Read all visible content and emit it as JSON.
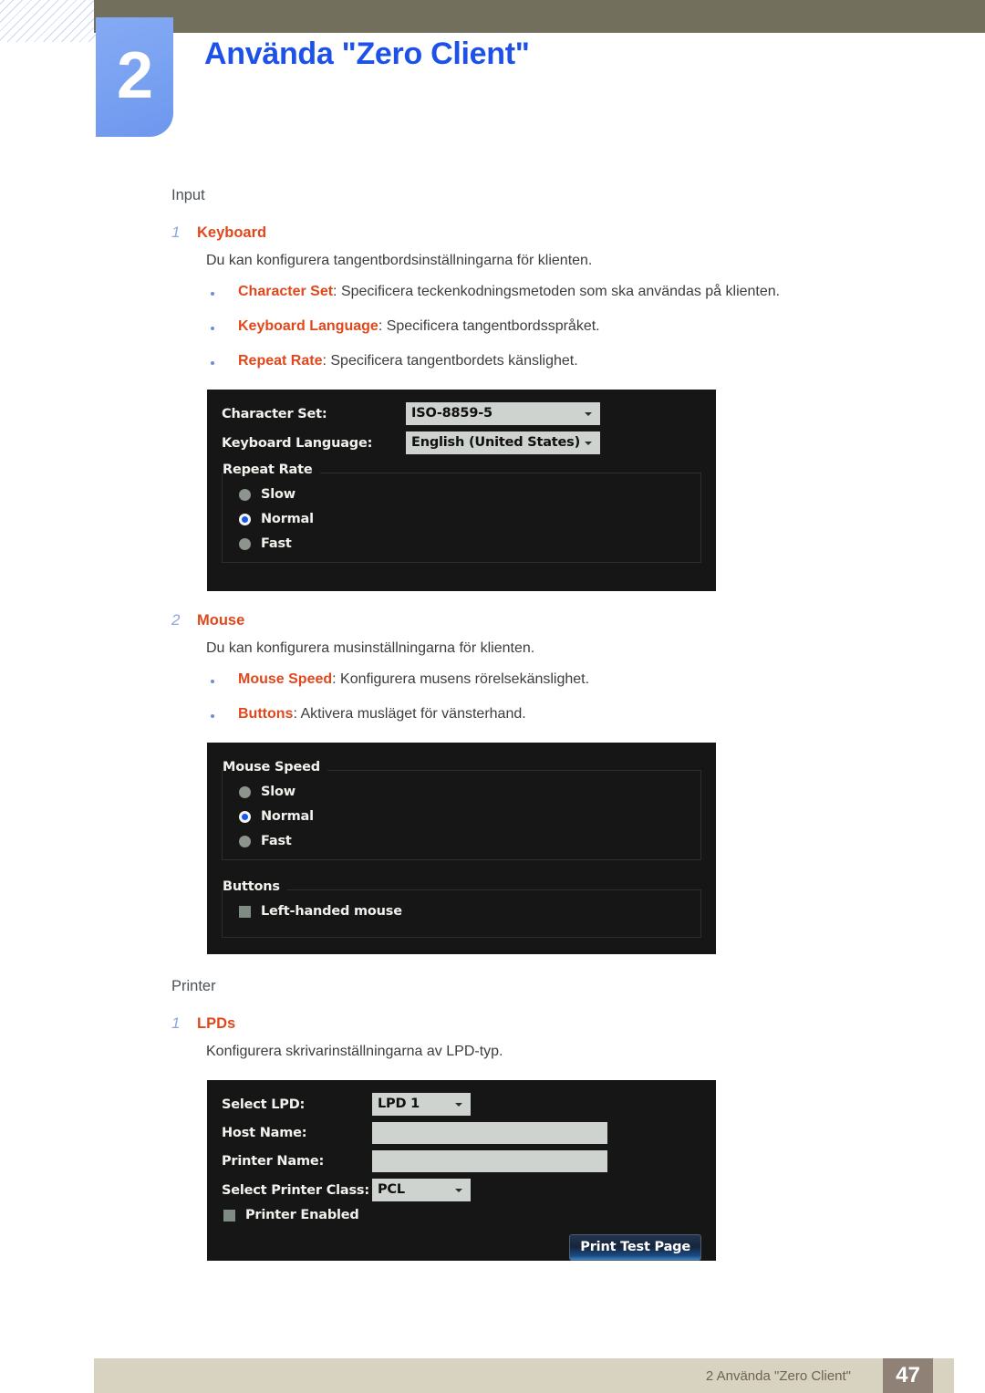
{
  "header": {
    "chapter_number": "2",
    "chapter_title": "Använda \"Zero Client\"",
    "accent_color": "#1e51e8",
    "badge_color": "#7ba3f2",
    "topbar_color": "#72705c"
  },
  "sections": [
    {
      "heading": "Input",
      "items": [
        {
          "number": "1",
          "title": "Keyboard",
          "paragraph": "Du kan konfigurera tangentbordsinställningarna för klienten.",
          "bullets": [
            {
              "term": "Character Set",
              "desc": ": Specificera teckenkodningsmetoden som ska användas på klienten."
            },
            {
              "term": "Keyboard Language",
              "desc": ": Specificera tangentbordsspråket."
            },
            {
              "term": "Repeat Rate",
              "desc": ": Specificera tangentbordets känslighet."
            }
          ]
        },
        {
          "number": "2",
          "title": "Mouse",
          "paragraph": "Du kan konfigurera musinställningarna för klienten.",
          "bullets": [
            {
              "term": "Mouse Speed",
              "desc": ": Konfigurera musens rörelsekänslighet."
            },
            {
              "term": "Buttons",
              "desc": ": Aktivera musläget för vänsterhand."
            }
          ]
        }
      ]
    },
    {
      "heading": "Printer",
      "items": [
        {
          "number": "1",
          "title": "LPDs",
          "paragraph": "Konfigurera skrivarinställningarna av LPD-typ.",
          "bullets": []
        }
      ]
    }
  ],
  "keyboard_panel": {
    "character_set_label": "Character Set:",
    "character_set_value": "ISO-8859-5",
    "keyboard_language_label": "Keyboard Language:",
    "keyboard_language_value": "English (United States)",
    "repeat_rate_group": "Repeat Rate",
    "repeat_rate_options": [
      {
        "label": "Slow",
        "selected": false
      },
      {
        "label": "Normal",
        "selected": true
      },
      {
        "label": "Fast",
        "selected": false
      }
    ]
  },
  "mouse_panel": {
    "mouse_speed_group": "Mouse Speed",
    "mouse_speed_options": [
      {
        "label": "Slow",
        "selected": false
      },
      {
        "label": "Normal",
        "selected": true
      },
      {
        "label": "Fast",
        "selected": false
      }
    ],
    "buttons_group": "Buttons",
    "left_handed_label": "Left-handed mouse",
    "left_handed_checked": false
  },
  "printer_panel": {
    "select_lpd_label": "Select LPD:",
    "select_lpd_value": "LPD 1",
    "host_name_label": "Host Name:",
    "host_name_value": "",
    "printer_name_label": "Printer Name:",
    "printer_name_value": "",
    "select_printer_class_label": "Select Printer Class:",
    "select_printer_class_value": "PCL",
    "printer_enabled_label": "Printer Enabled",
    "printer_enabled_checked": false,
    "print_test_page_button": "Print Test Page"
  },
  "footer": {
    "text": "2 Använda \"Zero Client\"",
    "page_number": "47",
    "bar_color": "#d8d2c0",
    "page_box_color": "#8f8176"
  }
}
